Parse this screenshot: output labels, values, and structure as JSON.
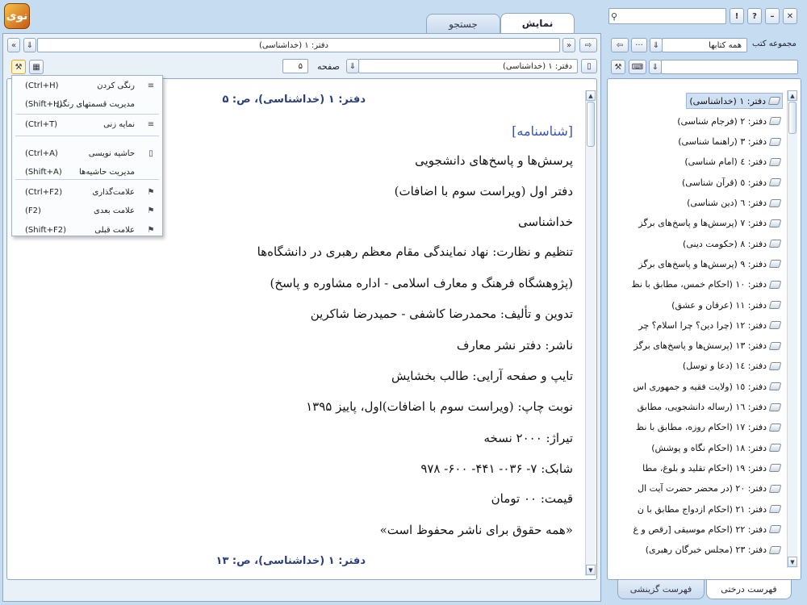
{
  "app": {
    "logo_text": "نوی"
  },
  "window": {
    "search_placeholder": "",
    "help": "!",
    "question": "?",
    "minimize": "–",
    "close": "✕"
  },
  "tabs": {
    "display": "نمایش",
    "search": "جستجو"
  },
  "right_header": {
    "collections_label": "مجموعه کتب",
    "collection_value": "همه کتابها",
    "more": "···"
  },
  "address": {
    "value": "دفتر: ۱ (خداشناسی)"
  },
  "toolbar": {
    "book_select": "دفتر: ۱ (خداشناسی)",
    "page_label": "صفحه",
    "page_value": "۵"
  },
  "content": {
    "ref_top": "دفتر: ۱ (خداشناسی)، ص: ۵",
    "heading": "[شناسنامه]",
    "lines": [
      "پرسش‌ها و پاسخ‌های دانشجویی",
      "دفتر اول (ویراست سوم با اضافات)",
      "خداشناسی",
      "تنظیم و نظارت: نهاد نمایندگی مقام معظم رهبری در دانشگاه‌ها",
      "(پژوهشگاه فرهنگ و معارف اسلامی - اداره مشاوره و پاسخ)",
      "تدوین و تألیف: محمدرضا کاشفی - حمیدرضا شاکرین",
      "ناشر: دفتر نشر معارف",
      "تایپ و صفحه آرایی: طالب بخشایش",
      "نوبت چاپ: (ویراست سوم با اضافات)اول، پاییز ۱۳۹۵",
      "تیراژ: ۲۰۰۰ نسخه",
      "شابک: ۷- ۰۳۶- ۴۴۱- ۶۰۰- ۹۷۸",
      "قیمت: ۰۰ تومان",
      "«همه حقوق برای ناشر محفوظ است»"
    ],
    "ref_bottom": "دفتر: ۱ (خداشناسی)، ص: ۱۳"
  },
  "menu": [
    {
      "label": "رنگی کردن",
      "shortcut": "(Ctrl+H)",
      "icon": "highlight-icon"
    },
    {
      "label": "مدیریت قسمتهای رنگی",
      "shortcut": "(Shift+H)",
      "icon": "none"
    },
    {
      "label": "نمایه زنی",
      "shortcut": "(Ctrl+T)",
      "icon": "index-icon"
    },
    {
      "label": "حاشیه نویسی",
      "shortcut": "(Ctrl+A)",
      "icon": "note-icon"
    },
    {
      "label": "مدیریت حاشیه‌ها",
      "shortcut": "(Shift+A)",
      "icon": "none"
    },
    {
      "label": "علامت‌گذاری",
      "shortcut": "(Ctrl+F2)",
      "icon": "bookmark-icon"
    },
    {
      "label": "علامت بعدی",
      "shortcut": "(F2)",
      "icon": "bookmark-next-icon"
    },
    {
      "label": "علامت قبلی",
      "shortcut": "(Shift+F2)",
      "icon": "bookmark-prev-icon"
    }
  ],
  "tree": [
    "دفتر: ۱ (خداشناسی)",
    "دفتر: ۲ (فرجام شناسی)",
    "دفتر: ۳ (راهنما شناسی)",
    "دفتر: ٤ (امام شناسی)",
    "دفتر: ٥ (قرآن شناسی)",
    "دفتر: ٦ (دین شناسی)",
    "دفتر: ۷ (پرسش‌ها و پاسخ‌های برگز",
    "دفتر: ۸ (حکومت دینی)",
    "دفتر: ۹ (پرسش‌ها و پاسخ‌های برگز",
    "دفتر: ۱۰ (احکام خمس، مطابق با نظ",
    "دفتر: ۱۱ (عرفان و عشق)",
    "دفتر: ۱۲ (چرا دین؟ چرا اسلام؟ چر",
    "دفتر: ۱۳ (پرسش‌ها و پاسخ‌های برگز",
    "دفتر: ۱٤ (دعا و توسل)",
    "دفتر: ۱٥ (ولایت فقیه و جمهوری اس",
    "دفتر: ۱٦ (رساله دانشجویی، مطابق",
    "دفتر: ۱۷ (احکام روزه، مطابق با نظ",
    "دفتر: ۱۸ (احکام نگاه و پوشش)",
    "دفتر: ۱۹ (احکام تقلید و بلوغ، مطا",
    "دفتر: ۲۰ (در محضر حضرت آیت ال",
    "دفتر: ۲۱ (احکام ازدواج مطابق با ن",
    "دفتر: ۲۲ (احکام موسیقی [رقص و غ",
    "دفتر: ۲۳ (مجلس خبرگان رهبری)"
  ],
  "bottom_tabs": {
    "tree": "فهرست درختی",
    "selective": "فهرست گزینشی"
  }
}
